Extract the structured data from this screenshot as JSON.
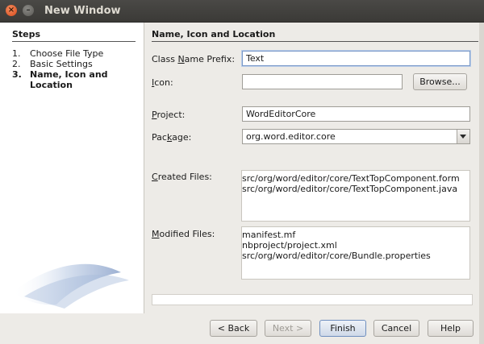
{
  "window": {
    "title": "New Window"
  },
  "steps": {
    "heading": "Steps",
    "items": [
      {
        "num": "1.",
        "label": "Choose File Type"
      },
      {
        "num": "2.",
        "label": "Basic Settings"
      },
      {
        "num": "3.",
        "label": "Name, Icon and Location"
      }
    ]
  },
  "panel": {
    "heading": "Name, Icon and Location",
    "class_prefix": {
      "label_pre": "Class ",
      "label_key": "N",
      "label_post": "ame Prefix:",
      "value": "Text"
    },
    "icon": {
      "label_key": "I",
      "label_post": "con:",
      "value": "",
      "browse": "Browse..."
    },
    "project": {
      "label_key": "P",
      "label_post": "roject:",
      "value": "WordEditorCore"
    },
    "package": {
      "label_pre": "Pac",
      "label_key": "k",
      "label_post": "age:",
      "value": "org.word.editor.core"
    },
    "created": {
      "label_key": "C",
      "label_post": "reated Files:",
      "files": [
        "src/org/word/editor/core/TextTopComponent.form",
        "src/org/word/editor/core/TextTopComponent.java"
      ]
    },
    "modified": {
      "label_key": "M",
      "label_post": "odified Files:",
      "files": [
        "manifest.mf",
        "nbproject/project.xml",
        "src/org/word/editor/core/Bundle.properties"
      ]
    }
  },
  "footer": {
    "back": "< Back",
    "next": "Next >",
    "finish": "Finish",
    "cancel": "Cancel",
    "help": "Help"
  }
}
